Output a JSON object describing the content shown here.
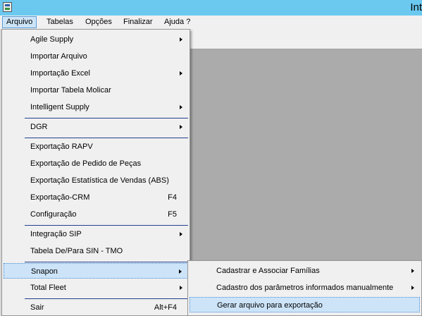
{
  "window": {
    "title_visible": "Int"
  },
  "menubar": [
    {
      "label": "Arquivo",
      "active": true
    },
    {
      "label": "Tabelas"
    },
    {
      "label": "Opções"
    },
    {
      "label": "Finalizar"
    },
    {
      "label": "Ajuda ?"
    }
  ],
  "arquivo_menu": [
    {
      "label": "Agile Supply",
      "submenu": true
    },
    {
      "label": "Importar Arquivo"
    },
    {
      "label": "Importação Excel",
      "submenu": true
    },
    {
      "label": "Importar Tabela Molicar"
    },
    {
      "label": "Intelligent Supply",
      "submenu": true
    },
    {
      "separator": true
    },
    {
      "label": "DGR",
      "submenu": true
    },
    {
      "separator": true
    },
    {
      "label": "Exportação RAPV"
    },
    {
      "label": "Exportação de Pedido de Peças"
    },
    {
      "label": "Exportação Estatística de Vendas (ABS)"
    },
    {
      "label": "Exportação-CRM",
      "shortcut": "F4"
    },
    {
      "label": "Configuração",
      "shortcut": "F5"
    },
    {
      "separator": true
    },
    {
      "label": "Integração SIP",
      "submenu": true
    },
    {
      "label": "Tabela De/Para SIN - TMO"
    },
    {
      "separator": true
    },
    {
      "label": "Snapon",
      "submenu": true,
      "highlighted": true
    },
    {
      "label": "Total Fleet",
      "submenu": true
    },
    {
      "separator": true
    },
    {
      "label": "Sair",
      "shortcut": "Alt+F4"
    }
  ],
  "snapon_submenu": [
    {
      "label": "Cadastrar e Associar Famílias",
      "submenu": true
    },
    {
      "label": "Cadastro dos parâmetros informados manualmente",
      "submenu": true
    },
    {
      "label": "Gerar arquivo para exportação",
      "highlighted": true
    }
  ]
}
